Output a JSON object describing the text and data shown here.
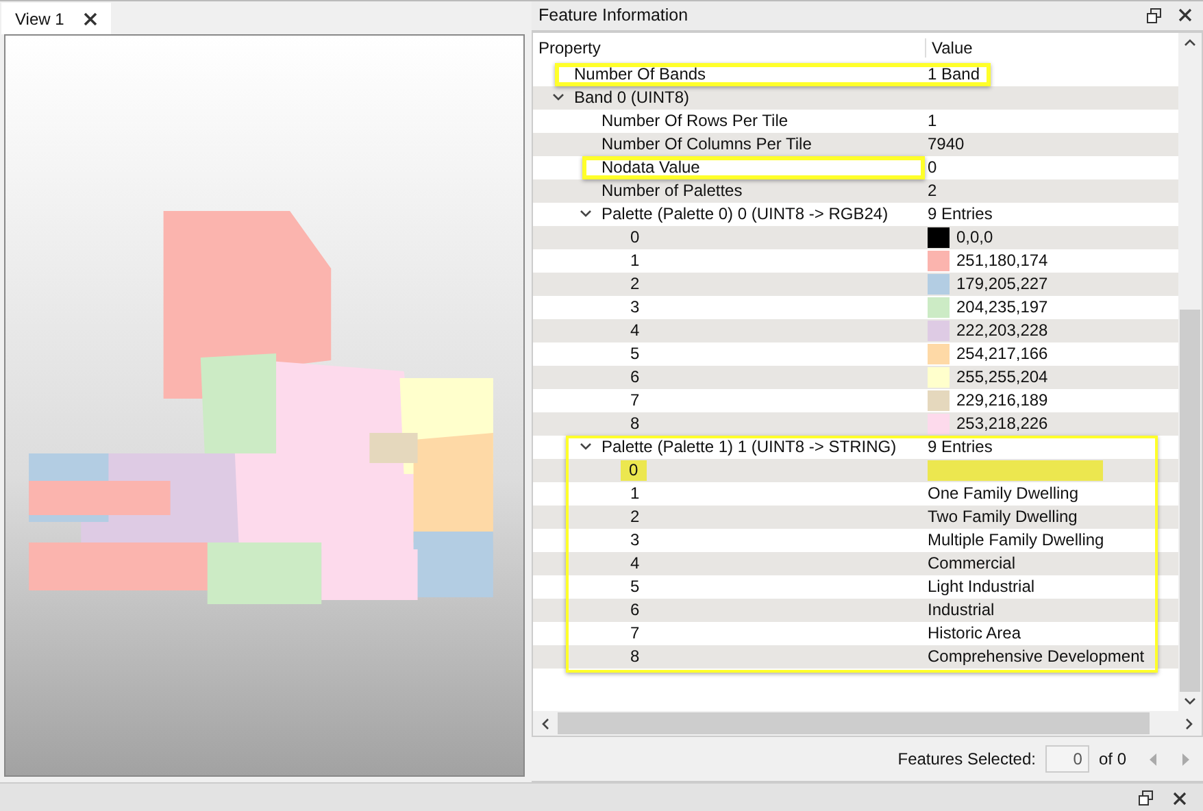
{
  "view_tabs": [
    {
      "label": "View 1",
      "selected": true
    }
  ],
  "panel": {
    "title": "Feature Information"
  },
  "table": {
    "columns": [
      "Property",
      "Value"
    ],
    "rows": [
      {
        "label": "Number Of Bands",
        "value": "1 Band",
        "outlined": true
      },
      {
        "label": "Band 0 (UINT8)",
        "expanded": true,
        "children": [
          {
            "label": "Number Of Rows Per Tile",
            "value": "1"
          },
          {
            "label": "Number Of Columns Per Tile",
            "value": "7940"
          },
          {
            "label": "Nodata Value",
            "value": "0",
            "outlined": true
          },
          {
            "label": "Number of Palettes",
            "value": "2"
          },
          {
            "label": "Palette (Palette 0) 0 (UINT8 -> RGB24)",
            "value": "9 Entries",
            "expanded": true,
            "children": [
              {
                "label": "0",
                "value": "0,0,0",
                "color": "#000000"
              },
              {
                "label": "1",
                "value": "251,180,174",
                "color": "#fbb4ae"
              },
              {
                "label": "2",
                "value": "179,205,227",
                "color": "#b3cde3"
              },
              {
                "label": "3",
                "value": "204,235,197",
                "color": "#ccebc5"
              },
              {
                "label": "4",
                "value": "222,203,228",
                "color": "#decbe4"
              },
              {
                "label": "5",
                "value": "254,217,166",
                "color": "#fed9a6"
              },
              {
                "label": "6",
                "value": "255,255,204",
                "color": "#ffffcc"
              },
              {
                "label": "7",
                "value": "229,216,189",
                "color": "#e5d8bd"
              },
              {
                "label": "8",
                "value": "253,218,226",
                "color": "#fddaec"
              }
            ]
          },
          {
            "label": "Palette (Palette 1) 1 (UINT8 -> STRING)",
            "value": "9 Entries",
            "expanded": true,
            "group_outlined": true,
            "children": [
              {
                "label": "0",
                "filled": true
              },
              {
                "label": "1",
                "value": "One Family Dwelling"
              },
              {
                "label": "2",
                "value": "Two Family Dwelling"
              },
              {
                "label": "3",
                "value": "Multiple Family Dwelling"
              },
              {
                "label": "4",
                "value": "Commercial"
              },
              {
                "label": "5",
                "value": "Light Industrial"
              },
              {
                "label": "6",
                "value": "Industrial"
              },
              {
                "label": "7",
                "value": "Historic Area"
              },
              {
                "label": "8",
                "value": "Comprehensive Development"
              }
            ]
          }
        ]
      }
    ]
  },
  "selection": {
    "label": "Features Selected:",
    "value": "0",
    "total": "of 0",
    "nav_disabled": true
  }
}
